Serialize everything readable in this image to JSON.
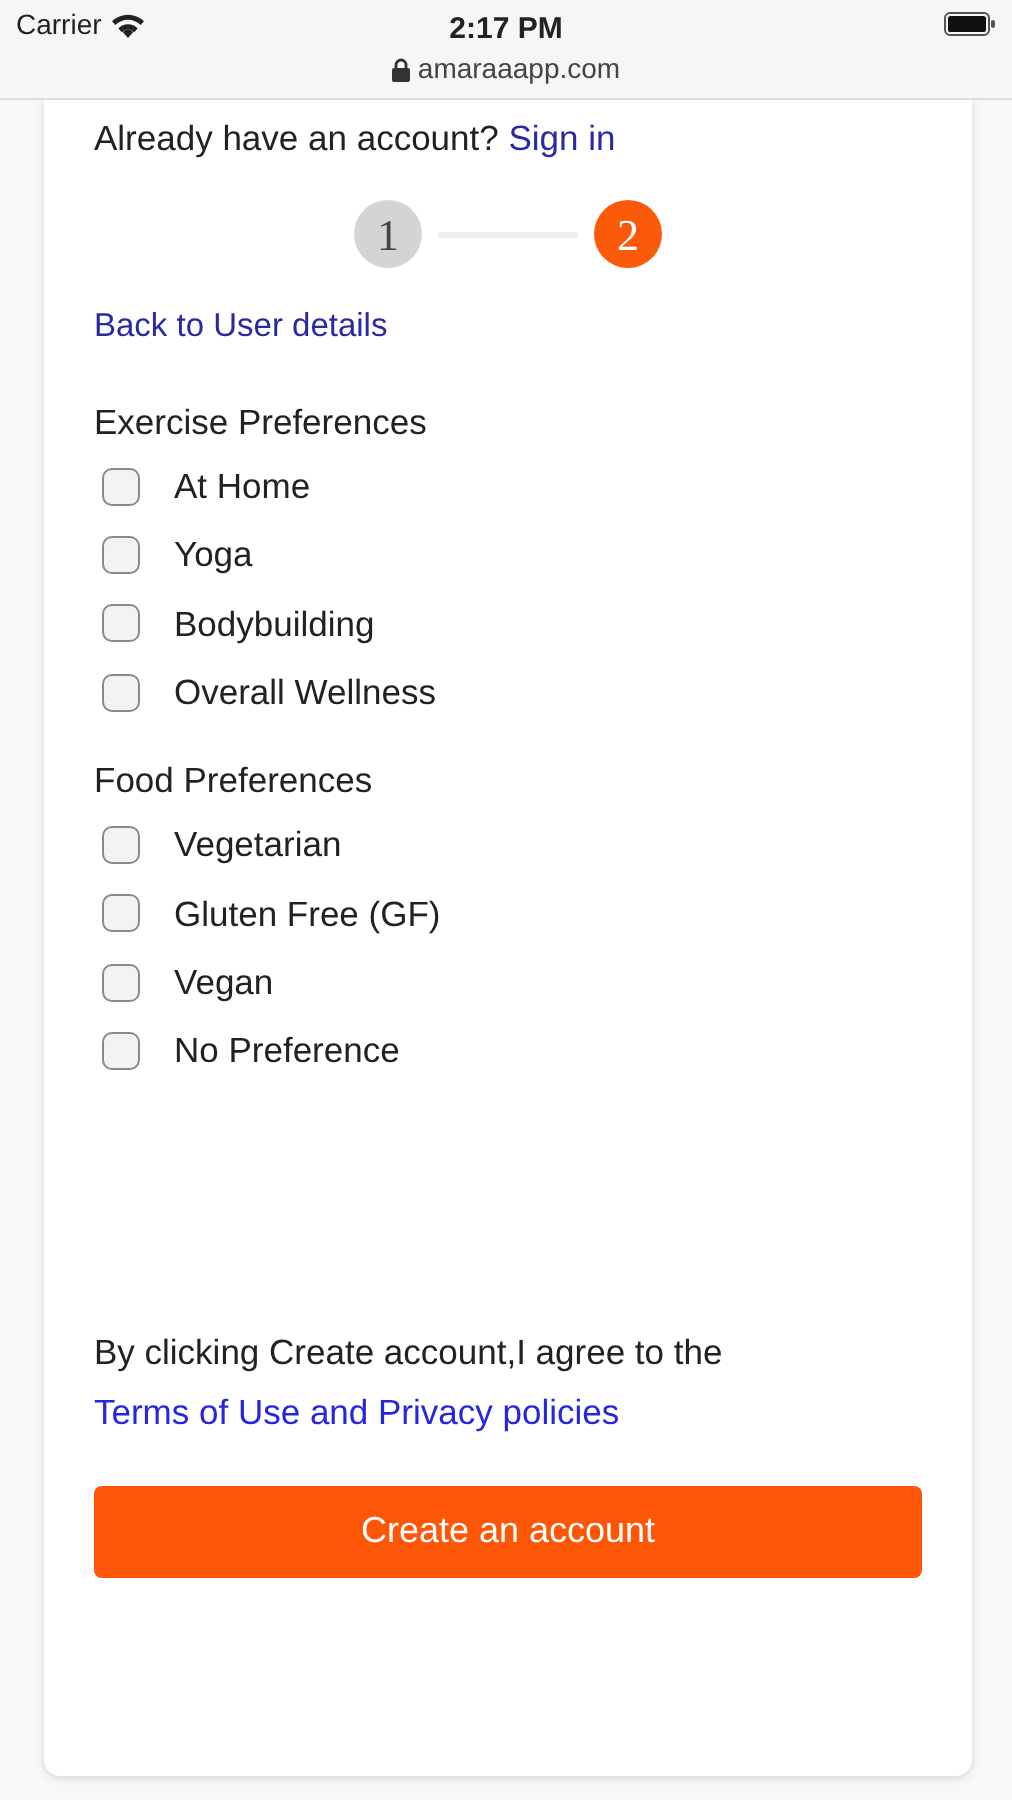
{
  "status_bar": {
    "carrier": "Carrier",
    "time": "2:17 PM",
    "url": "amaraaapp.com"
  },
  "signin_prompt": {
    "text": "Already have an account?",
    "link": "Sign in"
  },
  "steps": [
    {
      "label": "1",
      "selected": false
    },
    {
      "label": "2",
      "selected": true
    }
  ],
  "back_link": "Back to User details",
  "sections": [
    {
      "title": "Exercise Preferences",
      "options": [
        {
          "label": "At Home",
          "checked": false
        },
        {
          "label": "Yoga",
          "checked": false
        },
        {
          "label": "Bodybuilding",
          "checked": false
        },
        {
          "label": "Overall Wellness",
          "checked": false
        }
      ]
    },
    {
      "title": "Food Preferences",
      "options": [
        {
          "label": "Vegetarian",
          "checked": false
        },
        {
          "label": "Gluten Free (GF)",
          "checked": false
        },
        {
          "label": "Vegan",
          "checked": false
        },
        {
          "label": "No Preference",
          "checked": false
        }
      ]
    }
  ],
  "agreement": {
    "text": "By clicking Create account,I agree to the",
    "link": "Terms of Use and Privacy policies"
  },
  "submit_button": "Create an account"
}
